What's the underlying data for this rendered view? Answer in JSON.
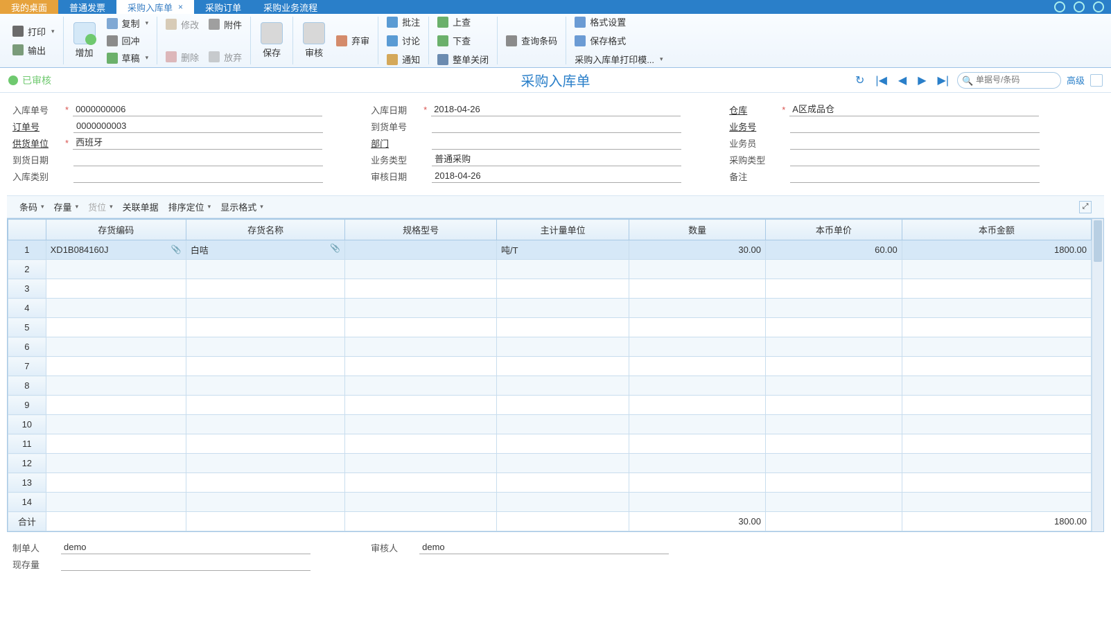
{
  "tabs": [
    {
      "label": "我的桌面",
      "cls": "home"
    },
    {
      "label": "普通发票",
      "cls": ""
    },
    {
      "label": "采购入库单",
      "cls": "active",
      "closable": true
    },
    {
      "label": "采购订单",
      "cls": ""
    },
    {
      "label": "采购业务流程",
      "cls": ""
    }
  ],
  "ribbon": {
    "print": "打印",
    "export": "输出",
    "add": "增加",
    "copy": "复制",
    "revert": "回冲",
    "draft": "草稿",
    "edit": "修改",
    "delete": "删除",
    "attach": "附件",
    "abandon": "放弃",
    "save": "保存",
    "audit": "审核",
    "reject": "弃审",
    "batch": "批注",
    "discuss": "讨论",
    "notify": "通知",
    "up": "上查",
    "down": "下查",
    "close_all": "整单关闭",
    "query_barcode": "查询条码",
    "format_set": "格式设置",
    "save_format": "保存格式",
    "print_template": "采购入库单打印模..."
  },
  "status": {
    "audited": "已审核",
    "title": "采购入库单",
    "search_placeholder": "单据号/条码",
    "advanced": "高级"
  },
  "header": {
    "in_no_label": "入库单号",
    "in_no": "0000000006",
    "order_no_label": "订单号",
    "order_no": "0000000003",
    "supplier_label": "供货单位",
    "supplier": "西班牙",
    "arrival_date_label": "到货日期",
    "arrival_date": "",
    "in_type_label": "入库类别",
    "in_type": "",
    "in_date_label": "入库日期",
    "in_date": "2018-04-26",
    "arrival_no_label": "到货单号",
    "arrival_no": "",
    "dept_label": "部门",
    "dept": "",
    "biz_type_label": "业务类型",
    "biz_type": "普通采购",
    "audit_date_label": "审核日期",
    "audit_date": "2018-04-26",
    "warehouse_label": "仓库",
    "warehouse": "A区成品仓",
    "biz_no_label": "业务号",
    "biz_no": "",
    "salesman_label": "业务员",
    "salesman": "",
    "purchase_type_label": "采购类型",
    "purchase_type": "",
    "remark_label": "备注",
    "remark": ""
  },
  "sub_toolbar": {
    "barcode": "条码",
    "stock": "存量",
    "position": "货位",
    "related": "关联单据",
    "sort": "排序定位",
    "display": "显示格式"
  },
  "table": {
    "headers": {
      "code": "存货编码",
      "name": "存货名称",
      "spec": "规格型号",
      "unit": "主计量单位",
      "qty": "数量",
      "price": "本币单价",
      "amount": "本币金额"
    },
    "rows": [
      {
        "idx": 1,
        "code": "XD1B084160J",
        "name": "白咭",
        "spec": "",
        "unit": "吨/T",
        "qty": "30.00",
        "price": "60.00",
        "amount": "1800.00"
      }
    ],
    "blank_rows": [
      2,
      3,
      4,
      5,
      6,
      7,
      8,
      9,
      10,
      11,
      12,
      13,
      14
    ],
    "totals_label": "合计",
    "totals": {
      "qty": "30.00",
      "amount": "1800.00"
    }
  },
  "footer": {
    "maker_label": "制单人",
    "maker": "demo",
    "auditor_label": "审核人",
    "auditor": "demo",
    "stock_label": "现存量",
    "stock": ""
  }
}
